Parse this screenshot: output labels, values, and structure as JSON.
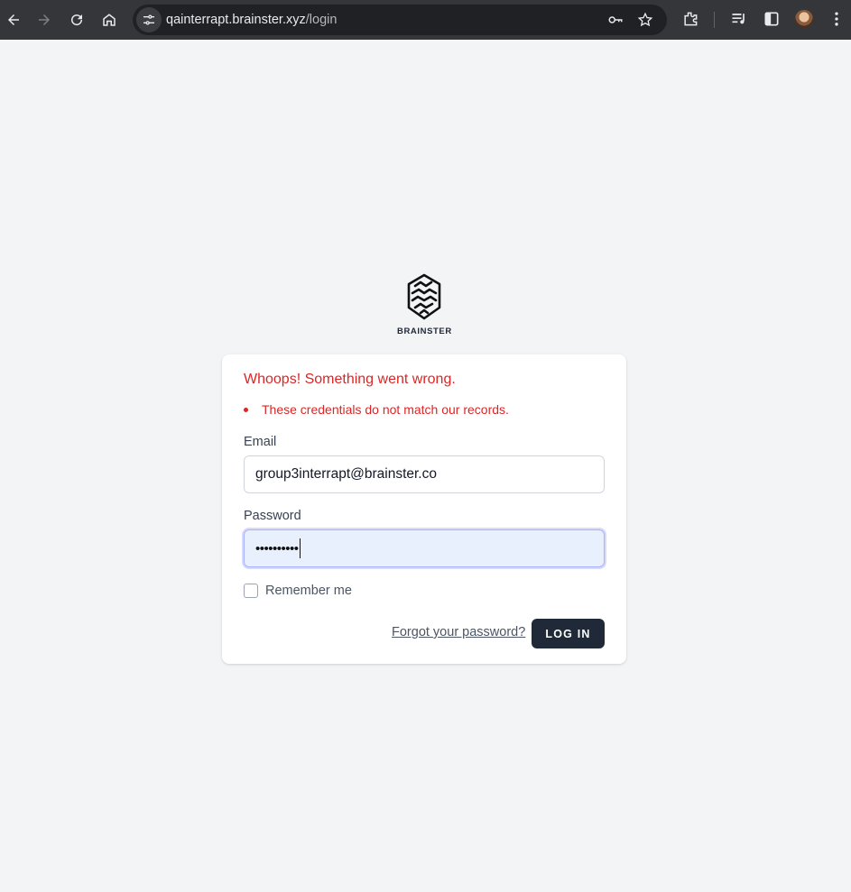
{
  "browser": {
    "url_host": "qainterrapt.brainster.xyz",
    "url_path": "/login",
    "icons": [
      "back-arrow-icon",
      "forward-arrow-icon",
      "reload-icon",
      "home-icon",
      "site-info-icon",
      "key-icon",
      "star-icon",
      "extensions-icon",
      "media-control-icon",
      "side-panel-icon",
      "profile-avatar",
      "more-vert-icon"
    ]
  },
  "logo": {
    "text": "BRAINSTER"
  },
  "errors": {
    "title": "Whoops! Something went wrong.",
    "items": [
      "These credentials do not match our records."
    ]
  },
  "form": {
    "email_label": "Email",
    "email_value": "group3interrapt@brainster.co",
    "password_label": "Password",
    "password_mask": "••••••••••",
    "remember_label": "Remember me",
    "remember_checked": false,
    "forgot_link": "Forgot your password?",
    "submit_label": "LOG IN"
  },
  "colors": {
    "error": "#dc2626",
    "button_bg": "#1f2937",
    "page_bg": "#f3f4f6",
    "autofill_bg": "#e8f0fe"
  }
}
